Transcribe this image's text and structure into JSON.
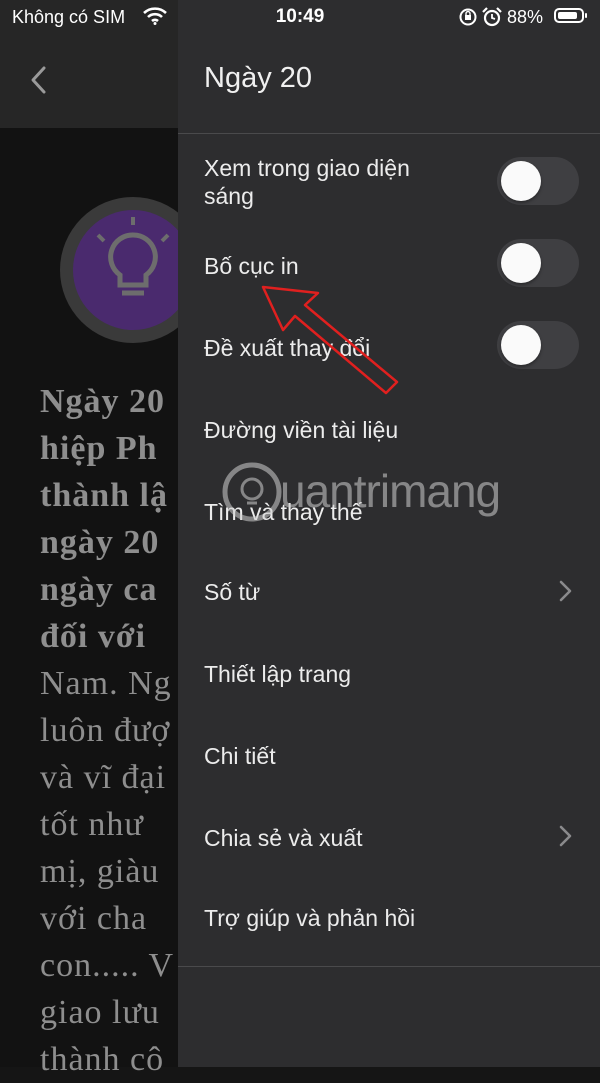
{
  "status_bar": {
    "carrier": "Không có SIM",
    "time": "10:49",
    "battery_percent": "88%",
    "battery_level": 0.88
  },
  "document": {
    "lines": [
      {
        "text": "Ngày 20",
        "bold": true
      },
      {
        "text": "hiệp Ph",
        "bold": true
      },
      {
        "text": "thành lậ",
        "bold": true
      },
      {
        "text": "ngày 20",
        "bold": true
      },
      {
        "text": "ngày ca",
        "bold": true
      },
      {
        "text": "đối với",
        "bold": true
      },
      {
        "text": "Nam. Ng",
        "bold": false
      },
      {
        "text": "luôn đượ",
        "bold": false
      },
      {
        "text": "và vĩ đại",
        "bold": false
      },
      {
        "text": "tốt như",
        "bold": false
      },
      {
        "text": "mị, giàu",
        "bold": false
      },
      {
        "text": "với cha",
        "bold": false
      },
      {
        "text": "con..... V",
        "bold": false
      },
      {
        "text": "giao lưu",
        "bold": false
      },
      {
        "text": "thành cô",
        "bold": false
      }
    ]
  },
  "drawer": {
    "title": "Ngày 20",
    "items": [
      {
        "label": "Xem trong giao diện sáng",
        "control": "toggle",
        "on": false
      },
      {
        "label": "Bố cục in",
        "control": "toggle",
        "on": false
      },
      {
        "label": "Đề xuất thay đổi",
        "control": "toggle",
        "on": false
      },
      {
        "label": "Đường viền tài liệu",
        "control": "none"
      },
      {
        "label": "Tìm và thay thế",
        "control": "none"
      },
      {
        "label": "Số từ",
        "control": "chevron"
      },
      {
        "label": "Thiết lập trang",
        "control": "none"
      },
      {
        "label": "Chi tiết",
        "control": "none"
      },
      {
        "label": "Chia sẻ và xuất",
        "control": "chevron"
      },
      {
        "label": "Trợ giúp và phản hồi",
        "control": "none"
      }
    ]
  },
  "watermark": {
    "text": "uantrimang"
  },
  "colors": {
    "drawer_bg": "#2d2d2f",
    "arrow": "#e0201f",
    "toggle_track": "#3f3f42",
    "document_logo": "#4a2a6e"
  }
}
